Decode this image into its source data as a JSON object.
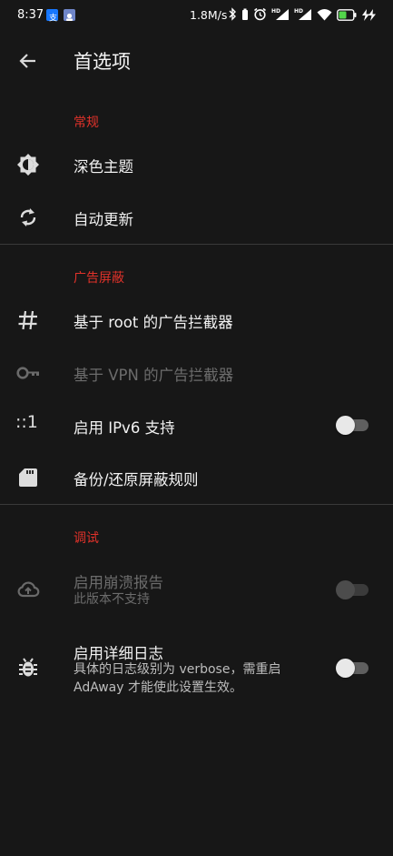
{
  "status_bar": {
    "time": "8:37",
    "net_speed": "1.8M/s",
    "battery": "41"
  },
  "app_bar": {
    "title": "首选项"
  },
  "sections": {
    "general": {
      "header": "常规",
      "dark_theme": "深色主题",
      "auto_update": "自动更新"
    },
    "ad_blocking": {
      "header": "广告屏蔽",
      "root_blocker": "基于 root 的广告拦截器",
      "vpn_blocker": "基于 VPN 的广告拦截器",
      "ipv6_icon_text": "::1",
      "ipv6": "启用 IPv6 支持",
      "backup": "备份/还原屏蔽规则"
    },
    "debug": {
      "header": "调试",
      "crash_report": "启用崩溃报告",
      "crash_report_sub": "此版本不支持",
      "verbose_log": "启用详细日志",
      "verbose_log_sub_1": "具体的日志级别为 verbose，需重启",
      "verbose_log_sub_2": "AdAway 才能使此设置生效。"
    }
  },
  "colors": {
    "background": "#171717",
    "accent": "#e0322a",
    "text": "#f2f2f2",
    "disabled_text": "#6c6c6c"
  },
  "toggles": {
    "ipv6": false,
    "crash_report": false,
    "verbose_log": false
  }
}
